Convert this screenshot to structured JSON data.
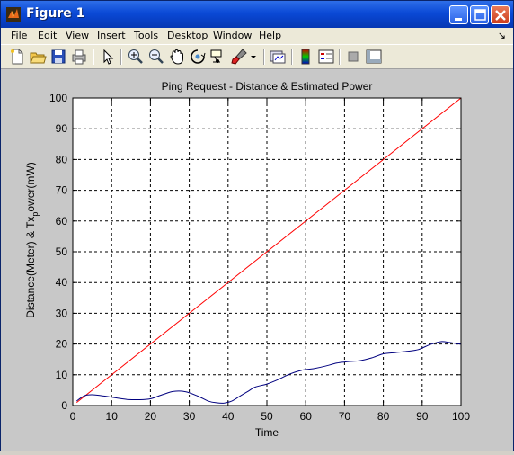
{
  "window": {
    "title": "Figure 1",
    "icon": "matlab-logo-icon",
    "controls": [
      "minimize",
      "maximize",
      "close"
    ]
  },
  "menubar": {
    "items": [
      "File",
      "Edit",
      "View",
      "Insert",
      "Tools",
      "Desktop",
      "Window",
      "Help"
    ],
    "dock_arrow": "↘"
  },
  "toolbar": {
    "tools": [
      "new-figure-icon",
      "open-file-icon",
      "save-figure-icon",
      "print-figure-icon",
      "edit-plot-arrow-icon",
      "zoom-in-icon",
      "zoom-out-icon",
      "pan-hand-icon",
      "rotate-3d-icon",
      "data-cursor-icon",
      "brush-icon",
      "brush-dropdown-icon",
      "link-plot-icon",
      "insert-colorbar-icon",
      "insert-legend-icon",
      "hide-plot-tools-icon",
      "show-plot-tools-icon"
    ]
  },
  "chart_data": {
    "type": "line",
    "title": "Ping Request - Distance & Estimated Power",
    "xlabel": "Time",
    "ylabel": "Distance(Meter) & Tx",
    "ylabel_sub": "p",
    "ylabel_tail": "ower(mW)",
    "xlim": [
      0,
      100
    ],
    "ylim": [
      0,
      100
    ],
    "xticks": [
      0,
      10,
      20,
      30,
      40,
      50,
      60,
      70,
      80,
      90,
      100
    ],
    "yticks": [
      0,
      10,
      20,
      30,
      40,
      50,
      60,
      70,
      80,
      90,
      100
    ],
    "grid": true,
    "series": [
      {
        "color": "#ff0000",
        "x": [
          1,
          100
        ],
        "y": [
          1,
          100
        ]
      },
      {
        "color": "#00007f",
        "x": [
          1,
          3,
          5,
          8,
          11,
          14,
          17,
          20,
          23,
          26,
          29,
          32,
          35,
          37,
          39,
          41,
          43,
          45,
          47,
          50,
          53,
          56,
          59,
          62,
          65,
          68,
          71,
          74,
          77,
          80,
          83,
          86,
          89,
          92,
          95,
          97,
          100
        ],
        "y": [
          1.5,
          3.2,
          3.5,
          3.1,
          2.5,
          2.0,
          1.9,
          2.2,
          3.5,
          4.6,
          4.5,
          3.2,
          1.4,
          0.9,
          0.8,
          1.5,
          3.0,
          4.5,
          6.0,
          7.0,
          8.5,
          10.3,
          11.5,
          12.0,
          12.8,
          13.8,
          14.3,
          14.6,
          15.5,
          16.8,
          17.2,
          17.6,
          18.2,
          19.8,
          20.8,
          20.5,
          19.9
        ]
      }
    ]
  }
}
